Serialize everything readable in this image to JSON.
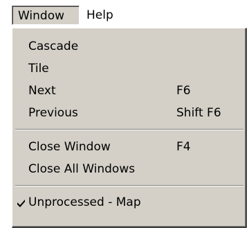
{
  "menubar": {
    "window_label": "Window",
    "help_label": "Help"
  },
  "menu": {
    "cascade": "Cascade",
    "tile": "Tile",
    "next": {
      "label": "Next",
      "shortcut": "F6"
    },
    "previous": {
      "label": "Previous",
      "shortcut": "Shift F6"
    },
    "close_window": {
      "label": "Close Window",
      "shortcut": "F4"
    },
    "close_all": "Close All Windows",
    "open_window": {
      "label": "Unprocessed - Map",
      "checked": true
    }
  },
  "icons": {
    "checkmark": "checkmark-icon"
  },
  "colors": {
    "menu_face": "#d4d0c8",
    "shadow": "#808080",
    "dark_shadow": "#404040",
    "highlight": "#ffffff"
  }
}
